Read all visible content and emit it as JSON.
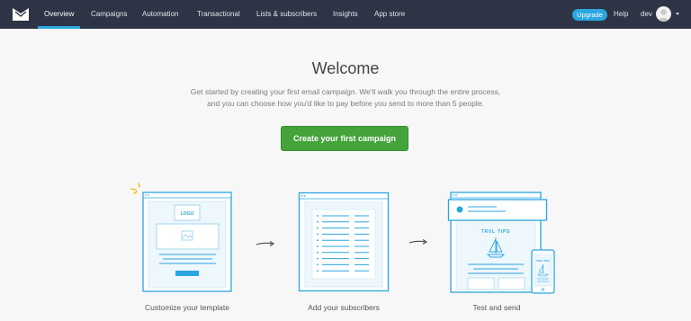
{
  "nav": {
    "items": [
      {
        "label": "Overview",
        "active": true
      },
      {
        "label": "Campaigns"
      },
      {
        "label": "Automation"
      },
      {
        "label": "Transactional"
      },
      {
        "label": "Lists & subscribers"
      },
      {
        "label": "Insights"
      },
      {
        "label": "App store"
      }
    ],
    "upgrade_label": "Upgrade",
    "help_label": "Help",
    "user_label": "dev"
  },
  "hero": {
    "title": "Welcome",
    "subtitle_line1": "Get started by creating your first email campaign. We'll walk you through the entire process,",
    "subtitle_line2": "and you can choose how you'd like to pay before you send to more than 5 people.",
    "cta_label": "Create your first campaign"
  },
  "steps": [
    {
      "label": "Customize your template",
      "icon": "template-icon",
      "placeholder_text": "LOGO"
    },
    {
      "label": "Add your subscribers",
      "icon": "subscriber-list-icon"
    },
    {
      "label": "Test and send",
      "icon": "test-send-icon",
      "preview_text": "TRVL TIPS"
    }
  ],
  "colors": {
    "nav_bg": "#2c3445",
    "accent": "#2ba6e0",
    "cta": "#44a33a",
    "highlight": "#f5b800"
  }
}
